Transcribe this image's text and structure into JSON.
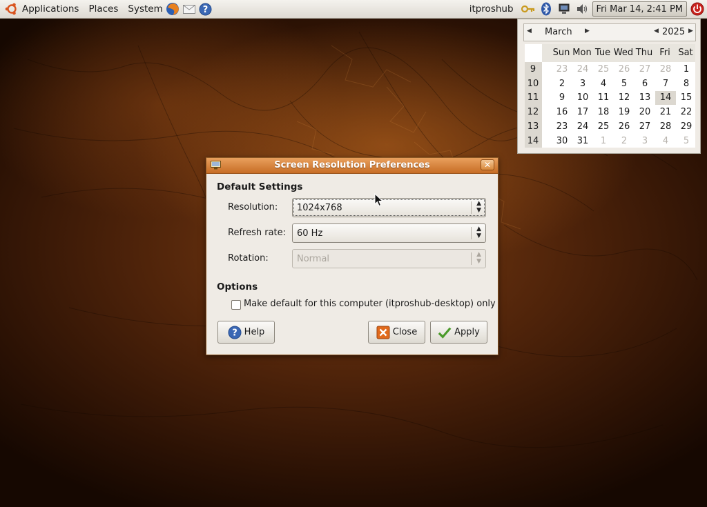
{
  "panel": {
    "menus": [
      {
        "label": "Applications",
        "icon": "ubuntu-logo-icon"
      },
      {
        "label": "Places"
      },
      {
        "label": "System"
      }
    ],
    "launchers": [
      "firefox-icon",
      "mail-icon",
      "help-icon"
    ],
    "username": "itproshub",
    "tray_icons": [
      "keys-icon",
      "bluetooth-icon",
      "network-icon",
      "volume-icon"
    ],
    "clock": "Fri Mar 14,  2:41 PM",
    "power_icon": "power-icon"
  },
  "calendar": {
    "month": "March",
    "year": "2025",
    "day_headers": [
      "Sun",
      "Mon",
      "Tue",
      "Wed",
      "Thu",
      "Fri",
      "Sat"
    ],
    "weeks": [
      {
        "num": "9",
        "days": [
          {
            "d": "23",
            "out": true
          },
          {
            "d": "24",
            "out": true
          },
          {
            "d": "25",
            "out": true
          },
          {
            "d": "26",
            "out": true
          },
          {
            "d": "27",
            "out": true
          },
          {
            "d": "28",
            "out": true
          },
          {
            "d": "1"
          }
        ]
      },
      {
        "num": "10",
        "days": [
          {
            "d": "2"
          },
          {
            "d": "3"
          },
          {
            "d": "4"
          },
          {
            "d": "5"
          },
          {
            "d": "6"
          },
          {
            "d": "7"
          },
          {
            "d": "8"
          }
        ]
      },
      {
        "num": "11",
        "days": [
          {
            "d": "9"
          },
          {
            "d": "10"
          },
          {
            "d": "11"
          },
          {
            "d": "12"
          },
          {
            "d": "13"
          },
          {
            "d": "14",
            "selected": true
          },
          {
            "d": "15"
          }
        ]
      },
      {
        "num": "12",
        "days": [
          {
            "d": "16"
          },
          {
            "d": "17"
          },
          {
            "d": "18"
          },
          {
            "d": "19"
          },
          {
            "d": "20"
          },
          {
            "d": "21"
          },
          {
            "d": "22"
          }
        ]
      },
      {
        "num": "13",
        "days": [
          {
            "d": "23"
          },
          {
            "d": "24"
          },
          {
            "d": "25"
          },
          {
            "d": "26"
          },
          {
            "d": "27"
          },
          {
            "d": "28"
          },
          {
            "d": "29"
          }
        ]
      },
      {
        "num": "14",
        "days": [
          {
            "d": "30"
          },
          {
            "d": "31"
          },
          {
            "d": "1",
            "out": true
          },
          {
            "d": "2",
            "out": true
          },
          {
            "d": "3",
            "out": true
          },
          {
            "d": "4",
            "out": true
          },
          {
            "d": "5",
            "out": true
          }
        ]
      }
    ]
  },
  "dialog": {
    "title": "Screen Resolution Preferences",
    "default_settings_heading": "Default Settings",
    "resolution": {
      "label": "Resolution:",
      "value": "1024x768"
    },
    "refresh_rate": {
      "label": "Refresh rate:",
      "value": "60 Hz"
    },
    "rotation": {
      "label": "Rotation:",
      "value": "Normal",
      "disabled": true
    },
    "options_heading": "Options",
    "make_default": {
      "label": "Make default for this computer (itproshub-desktop) only",
      "checked": false
    },
    "buttons": {
      "help": "Help",
      "close": "Close",
      "apply": "Apply"
    }
  },
  "colors": {
    "titlebar": "#d88437",
    "desktop": "#4e230a",
    "dialog_bg": "#efebe5"
  }
}
